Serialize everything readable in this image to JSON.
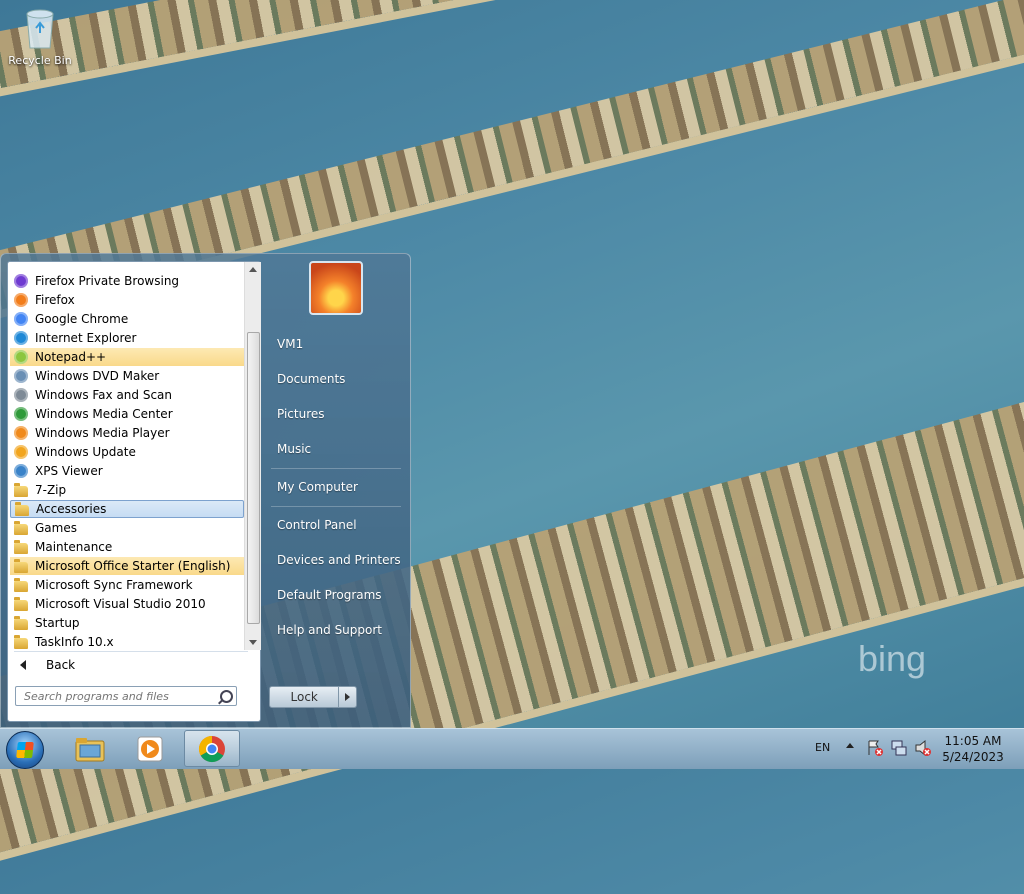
{
  "desktop": {
    "recycle_bin_label": "Recycle Bin",
    "watermark": "bing"
  },
  "start_menu": {
    "programs": [
      {
        "label": "Firefox Private Browsing",
        "icon": "firefox-private-icon"
      },
      {
        "label": "Firefox",
        "icon": "firefox-icon"
      },
      {
        "label": "Google Chrome",
        "icon": "chrome-icon"
      },
      {
        "label": "Internet Explorer",
        "icon": "ie-icon"
      },
      {
        "label": "Notepad++",
        "icon": "notepadpp-icon",
        "highlight": true
      },
      {
        "label": "Windows DVD Maker",
        "icon": "dvd-maker-icon"
      },
      {
        "label": "Windows Fax and Scan",
        "icon": "fax-scan-icon"
      },
      {
        "label": "Windows Media Center",
        "icon": "media-center-icon"
      },
      {
        "label": "Windows Media Player",
        "icon": "media-player-icon"
      },
      {
        "label": "Windows Update",
        "icon": "windows-update-icon"
      },
      {
        "label": "XPS Viewer",
        "icon": "xps-viewer-icon"
      },
      {
        "label": "7-Zip",
        "icon": "folder-icon"
      },
      {
        "label": "Accessories",
        "icon": "folder-icon",
        "selected": true
      },
      {
        "label": "Games",
        "icon": "folder-icon"
      },
      {
        "label": "Maintenance",
        "icon": "folder-icon"
      },
      {
        "label": "Microsoft Office Starter (English)",
        "icon": "folder-icon",
        "highlight": true
      },
      {
        "label": "Microsoft Sync Framework",
        "icon": "folder-icon"
      },
      {
        "label": "Microsoft Visual Studio 2010",
        "icon": "folder-icon"
      },
      {
        "label": "Startup",
        "icon": "folder-icon"
      },
      {
        "label": "TaskInfo 10.x",
        "icon": "folder-icon"
      }
    ],
    "back_label": "Back",
    "search_placeholder": "Search programs and files",
    "right_items": {
      "user": "VM1",
      "documents": "Documents",
      "pictures": "Pictures",
      "music": "Music",
      "computer": "My Computer",
      "control_panel": "Control Panel",
      "devices": "Devices and Printers",
      "default_programs": "Default Programs",
      "help": "Help and Support"
    },
    "lock_label": "Lock"
  },
  "taskbar": {
    "language": "EN",
    "time": "11:05 AM",
    "date": "5/24/2023"
  }
}
